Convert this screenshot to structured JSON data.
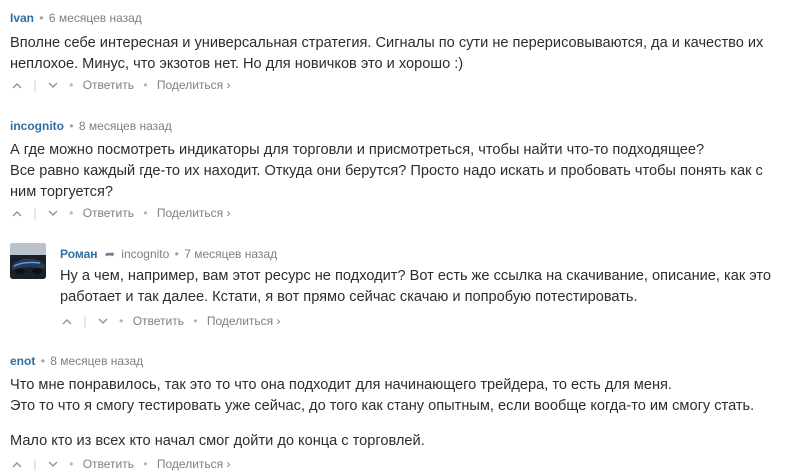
{
  "comments": [
    {
      "author": "Ivan",
      "time": "6 месяцев назад",
      "lines": [
        "Вполне себе интересная и универсальная стратегия. Сигналы по сути не перерисовываются, да и качество их",
        "неплохое. Минус, что экзотов нет. Но для новичков это и хорошо :)"
      ]
    },
    {
      "author": "incognito",
      "time": "8 месяцев назад",
      "lines": [
        "А где можно посмотреть индикаторы для торговли и присмотреться, чтобы найти что-то подходящее?",
        "Все равно каждый где-то их находит. Откуда они берутся? Просто надо искать и пробовать чтобы понять как с",
        "ним торгуется?"
      ]
    },
    {
      "author": "Роман",
      "reply_to": "incognito",
      "time": "7 месяцев назад",
      "lines": [
        "Ну а чем, например, вам этот ресурс не подходит? Вот есть же ссылка на скачивание, описание, как это",
        "работает и так далее. Кстати, я вот прямо сейчас скачаю и попробую потестировать."
      ]
    },
    {
      "author": "enot",
      "time": "8 месяцев назад",
      "lines": [
        "Что мне понравилось, так это то что она подходит для начинающего трейдера, то есть для меня.",
        "Это то что я смогу тестировать уже сейчас, до того как стану опытным, если вообще когда-то им смогу стать.",
        "Мало кто из всех кто начал смог дойти до конца с торговлей."
      ]
    }
  ],
  "actions": {
    "reply": "Ответить",
    "share": "Поделиться ›",
    "upvote_icon": "▲",
    "downvote_icon": "▼",
    "separator": "•",
    "header_separator": "•",
    "reply_arrow": "➦"
  }
}
